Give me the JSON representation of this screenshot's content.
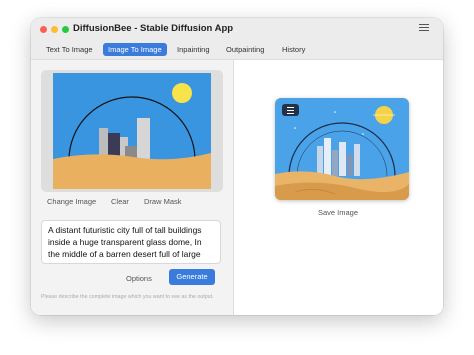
{
  "window": {
    "title": "DiffusionBee - Stable Diffusion App",
    "traffic_lights": {
      "close": "#ff5f57",
      "minimize": "#febc2e",
      "zoom": "#28c840"
    },
    "menu_icon": "hamburger-icon"
  },
  "tabs": [
    {
      "label": "Text To Image",
      "active": false
    },
    {
      "label": "Image To Image",
      "active": true
    },
    {
      "label": "Inpainting",
      "active": false
    },
    {
      "label": "Outpainting",
      "active": false
    },
    {
      "label": "History",
      "active": false
    }
  ],
  "left_panel": {
    "actions": {
      "change": "Change Image",
      "clear": "Clear",
      "draw_mask": "Draw Mask"
    },
    "prompt": {
      "value": "A distant futuristic city full of tall buildings inside a huge transparent glass dome, In the middle of a barren desert full of large dunes, Sun rays, Artstation, Dark sky full of stars with a shiny sun, Massive scale, Fog, Highly detailed, Cinematic, Colorful"
    },
    "options_label": "Options",
    "generate_label": "Generate",
    "helper_text": "Please describe the complete image which you want to see as the output."
  },
  "right_panel": {
    "save_label": "Save Image",
    "result_menu_icon": "hamburger-icon"
  },
  "colors": {
    "accent": "#3a7bdc",
    "sky": "#3a95e0",
    "sand": "#e8b05f",
    "sun": "#f8e34a"
  }
}
